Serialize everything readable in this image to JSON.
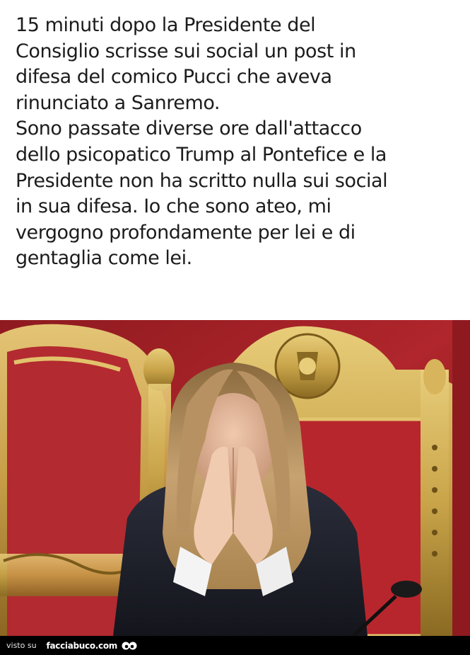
{
  "post": {
    "lines": [
      "15 minuti dopo la Presidente del",
      "Consiglio scrisse sui social un post in",
      "difesa del comico Pucci che aveva",
      "rinunciato a Sanremo.",
      "Sono passate diverse ore dall'attacco",
      "dello psicopatico Trump al Pontefice e la",
      "Presidente non ha scritto nulla sui social",
      "in sua difesa. Io che sono ateo, mi",
      "vergogno profondamente per lei e di",
      "gentaglia come lei."
    ]
  },
  "photo": {
    "subject": "woman-praying-hands-on-gilded-red-chair"
  },
  "footer": {
    "visto_label": "visto su",
    "brand": "facciabuco.com",
    "logo_icon": "eyes-icon"
  },
  "colors": {
    "text": "#1c1c1c",
    "footer_bg": "#000000",
    "chair_red": "#b0232a",
    "gold": "#c9a449"
  }
}
